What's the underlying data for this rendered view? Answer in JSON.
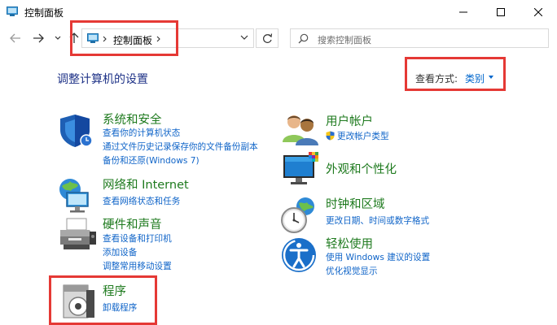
{
  "window": {
    "title": "控制面板"
  },
  "address": {
    "breadcrumb": "控制面板"
  },
  "search": {
    "placeholder": "搜索控制面板"
  },
  "main": {
    "heading": "调整计算机的设置",
    "view_by_label": "查看方式:",
    "view_by_value": "类别"
  },
  "categories": [
    {
      "title": "系统和安全",
      "icon": "shield-icon",
      "links": [
        "查看你的计算机状态",
        "通过文件历史记录保存你的文件备份副本",
        "备份和还原(Windows 7)"
      ]
    },
    {
      "title": "网络和 Internet",
      "icon": "network-globe-icon",
      "links": [
        "查看网络状态和任务"
      ]
    },
    {
      "title": "硬件和声音",
      "icon": "printer-icon",
      "links": [
        "查看设备和打印机",
        "添加设备",
        "调整常用移动设置"
      ]
    },
    {
      "title": "程序",
      "icon": "programs-icon",
      "links": [
        "卸载程序"
      ]
    },
    {
      "title": "用户帐户",
      "icon": "users-icon",
      "links": [
        "更改帐户类型"
      ]
    },
    {
      "title": "外观和个性化",
      "icon": "monitor-icon",
      "links": []
    },
    {
      "title": "时钟和区域",
      "icon": "clock-globe-icon",
      "links": [
        "更改日期、时间或数字格式"
      ]
    },
    {
      "title": "轻松使用",
      "icon": "ease-of-access-icon",
      "links": [
        "使用 Windows 建议的设置",
        "优化视觉显示"
      ]
    }
  ],
  "colors": {
    "title_green": "#1e7a1e",
    "link_blue": "#0f64c8",
    "heading_blue": "#1e3287",
    "highlight_red": "#e53935"
  }
}
